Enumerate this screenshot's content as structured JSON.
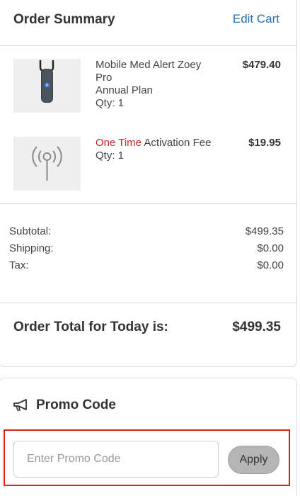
{
  "summary": {
    "title": "Order Summary",
    "edit_cart": "Edit Cart",
    "items": [
      {
        "name_line1": "Mobile Med Alert Zoey",
        "name_line2": "Pro",
        "plan": "Annual Plan",
        "qty": "Qty: 1",
        "price": "$479.40",
        "image_icon": "pendant-device-icon"
      },
      {
        "name_highlight": "One Time",
        "name_rest": " Activation Fee",
        "qty": "Qty: 1",
        "price": "$19.95",
        "image_icon": "antenna-signal-icon"
      }
    ],
    "totals": {
      "subtotal_label": "Subtotal:",
      "subtotal_value": "$499.35",
      "shipping_label": "Shipping:",
      "shipping_value": "$0.00",
      "tax_label": "Tax:",
      "tax_value": "$0.00"
    },
    "order_total_label": "Order Total for Today is:",
    "order_total_value": "$499.35"
  },
  "promo": {
    "title": "Promo Code",
    "icon": "megaphone-icon",
    "placeholder": "Enter Promo Code",
    "value": "",
    "apply_label": "Apply"
  },
  "colors": {
    "link": "#2d6fb0",
    "highlight_text": "#c62828",
    "focus_outline": "#e02020"
  }
}
